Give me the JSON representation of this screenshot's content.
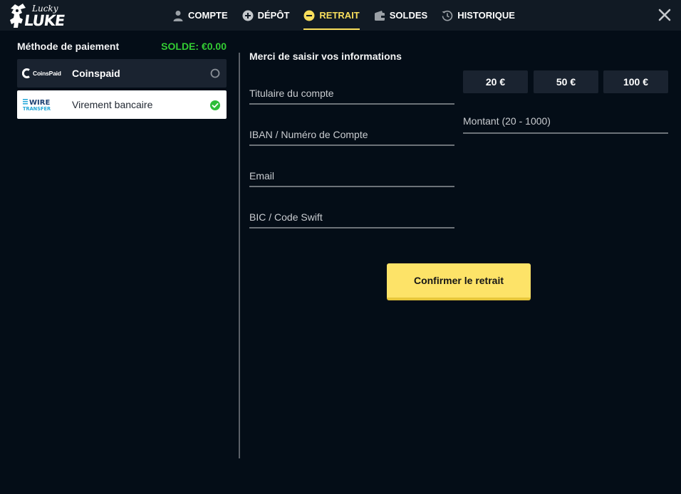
{
  "brand": {
    "logo_top": "Lucky",
    "logo_bottom": "LUKE"
  },
  "nav": {
    "items": [
      {
        "label": "COMPTE",
        "icon": "user-icon",
        "active": false
      },
      {
        "label": "DÉPÔT",
        "icon": "plus-circle-icon",
        "active": false
      },
      {
        "label": "RETRAIT",
        "icon": "minus-circle-icon",
        "active": true
      },
      {
        "label": "SOLDES",
        "icon": "wallet-icon",
        "active": false
      },
      {
        "label": "HISTORIQUE",
        "icon": "history-icon",
        "active": false
      }
    ],
    "active_color": "#f8de5c"
  },
  "left": {
    "title": "Méthode de paiement",
    "balance": "SOLDE: €0.00",
    "balance_color": "#33cc33",
    "methods": [
      {
        "name": "Coinspaid",
        "logo_text": "CoinsPaid",
        "selected": false
      },
      {
        "name": "Virement bancaire",
        "logo_text_top": "WIRE",
        "logo_text_bottom": "TRANSFER",
        "selected": true
      }
    ]
  },
  "form": {
    "title": "Merci de saisir vos informations",
    "fields": [
      {
        "placeholder": "Titulaire du compte"
      },
      {
        "placeholder": "IBAN / Numéro de Compte"
      },
      {
        "placeholder": "Email"
      },
      {
        "placeholder": "BIC / Code Swift"
      }
    ],
    "amount_presets": [
      "20 €",
      "50 €",
      "100 €"
    ],
    "amount_placeholder": "Montant (20 - 1000)",
    "confirm_label": "Confirmer le retrait",
    "confirm_color": "#fde368"
  }
}
